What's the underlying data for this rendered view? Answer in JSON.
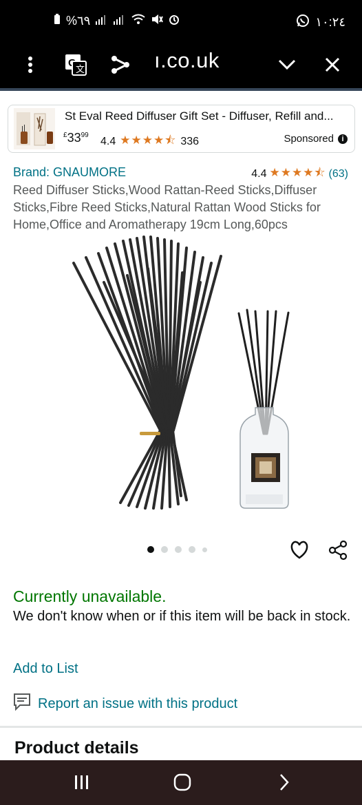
{
  "status_bar": {
    "battery_percent": "%٦٩",
    "time": "١٠:٢٤"
  },
  "url_bar": {
    "url": "ı.co.uk"
  },
  "sponsored": {
    "title": "St Eval Reed Diffuser Gift Set - Diffuser, Refill and...",
    "currency": "£",
    "price_whole": "33",
    "price_fraction": "99",
    "rating": "4.4",
    "stars": 4.4,
    "review_count": "336",
    "label": "Sponsored"
  },
  "product": {
    "brand": "Brand: GNAUMORE",
    "rating": "4.4",
    "stars": 4.4,
    "review_count": "(63)",
    "title": "Reed Diffuser Sticks,Wood Rattan-Reed Sticks,Diffuser Sticks,Fibre Reed Sticks,Natural Rattan Wood Sticks for Home,Office and Aromatherapy 19cm Long,60pcs",
    "image_count": 5,
    "current_image": 1
  },
  "availability": {
    "status": "Currently unavailable.",
    "note": "We don't know when or if this item will be back in stock."
  },
  "actions": {
    "add_to_list": "Add to List",
    "report_issue": "Report an issue with this product"
  },
  "sections": {
    "product_details": "Product details"
  },
  "colors": {
    "link": "#007185",
    "available": "#007600",
    "star": "#de7921"
  }
}
